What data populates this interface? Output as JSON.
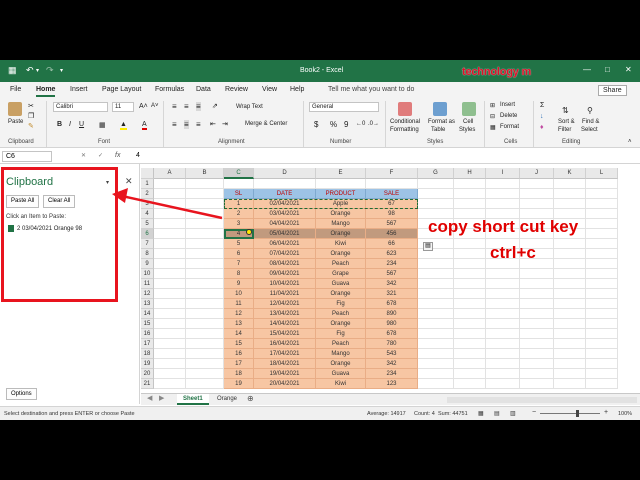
{
  "app": {
    "title": "Book2 - Excel",
    "brand": "technology m"
  },
  "tabs": [
    "File",
    "Home",
    "Insert",
    "Page Layout",
    "Formulas",
    "Data",
    "Review",
    "View",
    "Help"
  ],
  "tell_me": "Tell me what you want to do",
  "share": "Share",
  "ribbon": {
    "paste": "Paste",
    "font_name": "Calibri",
    "font_size": "11",
    "wrap_text": "Wrap Text",
    "merge_center": "Merge & Center",
    "number_format": "General",
    "currency": "$",
    "percent": "%",
    "comma": "9",
    "conditional_formatting": [
      "Conditional",
      "Formatting"
    ],
    "format_as_table": [
      "Format as",
      "Table"
    ],
    "cell_styles": [
      "Cell",
      "Styles"
    ],
    "insert": "Insert",
    "delete": "Delete",
    "format": "Format",
    "sort_filter": [
      "Sort &",
      "Filter"
    ],
    "find_select": [
      "Find &",
      "Select"
    ],
    "groups": [
      "Clipboard",
      "Font",
      "Alignment",
      "Number",
      "Styles",
      "Cells",
      "Editing"
    ]
  },
  "formula_bar": {
    "name_box": "C6",
    "fx": "fx",
    "value": "4"
  },
  "clipboard_pane": {
    "title": "Clipboard",
    "paste_all": "Paste All",
    "clear_all": "Clear All",
    "hint": "Click an Item to Paste:",
    "item": "2 03/04/2021 Orange 98",
    "options": "Options"
  },
  "sheet": {
    "columns": [
      "A",
      "B",
      "C",
      "D",
      "E",
      "F",
      "G",
      "H",
      "I",
      "J",
      "K",
      "L"
    ],
    "selected_column": "C",
    "selected_row": 6,
    "header": [
      "SL",
      "DATE",
      "PRODUCT",
      "SALE"
    ],
    "rows": [
      [
        "1",
        "02/04/2021",
        "Apple",
        "67"
      ],
      [
        "2",
        "03/04/2021",
        "Orange",
        "98"
      ],
      [
        "3",
        "04/04/2021",
        "Mango",
        "567"
      ],
      [
        "4",
        "05/04/2021",
        "Orange",
        "456"
      ],
      [
        "5",
        "06/04/2021",
        "Kiwi",
        "66"
      ],
      [
        "6",
        "07/04/2021",
        "Orange",
        "623"
      ],
      [
        "7",
        "08/04/2021",
        "Peach",
        "234"
      ],
      [
        "8",
        "09/04/2021",
        "Grape",
        "567"
      ],
      [
        "9",
        "10/04/2021",
        "Guava",
        "342"
      ],
      [
        "10",
        "11/04/2021",
        "Orange",
        "321"
      ],
      [
        "11",
        "12/04/2021",
        "Fig",
        "678"
      ],
      [
        "12",
        "13/04/2021",
        "Peach",
        "890"
      ],
      [
        "13",
        "14/04/2021",
        "Orange",
        "980"
      ],
      [
        "14",
        "15/04/2021",
        "Fig",
        "678"
      ],
      [
        "15",
        "16/04/2021",
        "Peach",
        "780"
      ],
      [
        "16",
        "17/04/2021",
        "Mango",
        "543"
      ],
      [
        "17",
        "18/04/2021",
        "Orange",
        "342"
      ],
      [
        "18",
        "19/04/2021",
        "Guava",
        "234"
      ],
      [
        "19",
        "20/04/2021",
        "Kiwi",
        "123"
      ]
    ],
    "row_numbers": [
      "1",
      "2",
      "3",
      "4",
      "5",
      "6",
      "7",
      "8",
      "9",
      "10",
      "11",
      "12",
      "13",
      "14",
      "15",
      "16",
      "17",
      "18",
      "19",
      "20",
      "21"
    ]
  },
  "annotation": {
    "line1": "copy short cut key",
    "line2": "ctrl+c"
  },
  "sheet_tabs": [
    "Sheet1",
    "Orange"
  ],
  "status": {
    "message": "Select destination and press ENTER or choose Paste",
    "average": "Average: 14917",
    "count": "Count: 4",
    "sum": "Sum: 44751",
    "zoom": "100%"
  },
  "colors": {
    "excel_green": "#217346",
    "table_fill": "#f7c6a3",
    "table_header": "#9dc3e6",
    "highlight_red": "#e8141e"
  }
}
